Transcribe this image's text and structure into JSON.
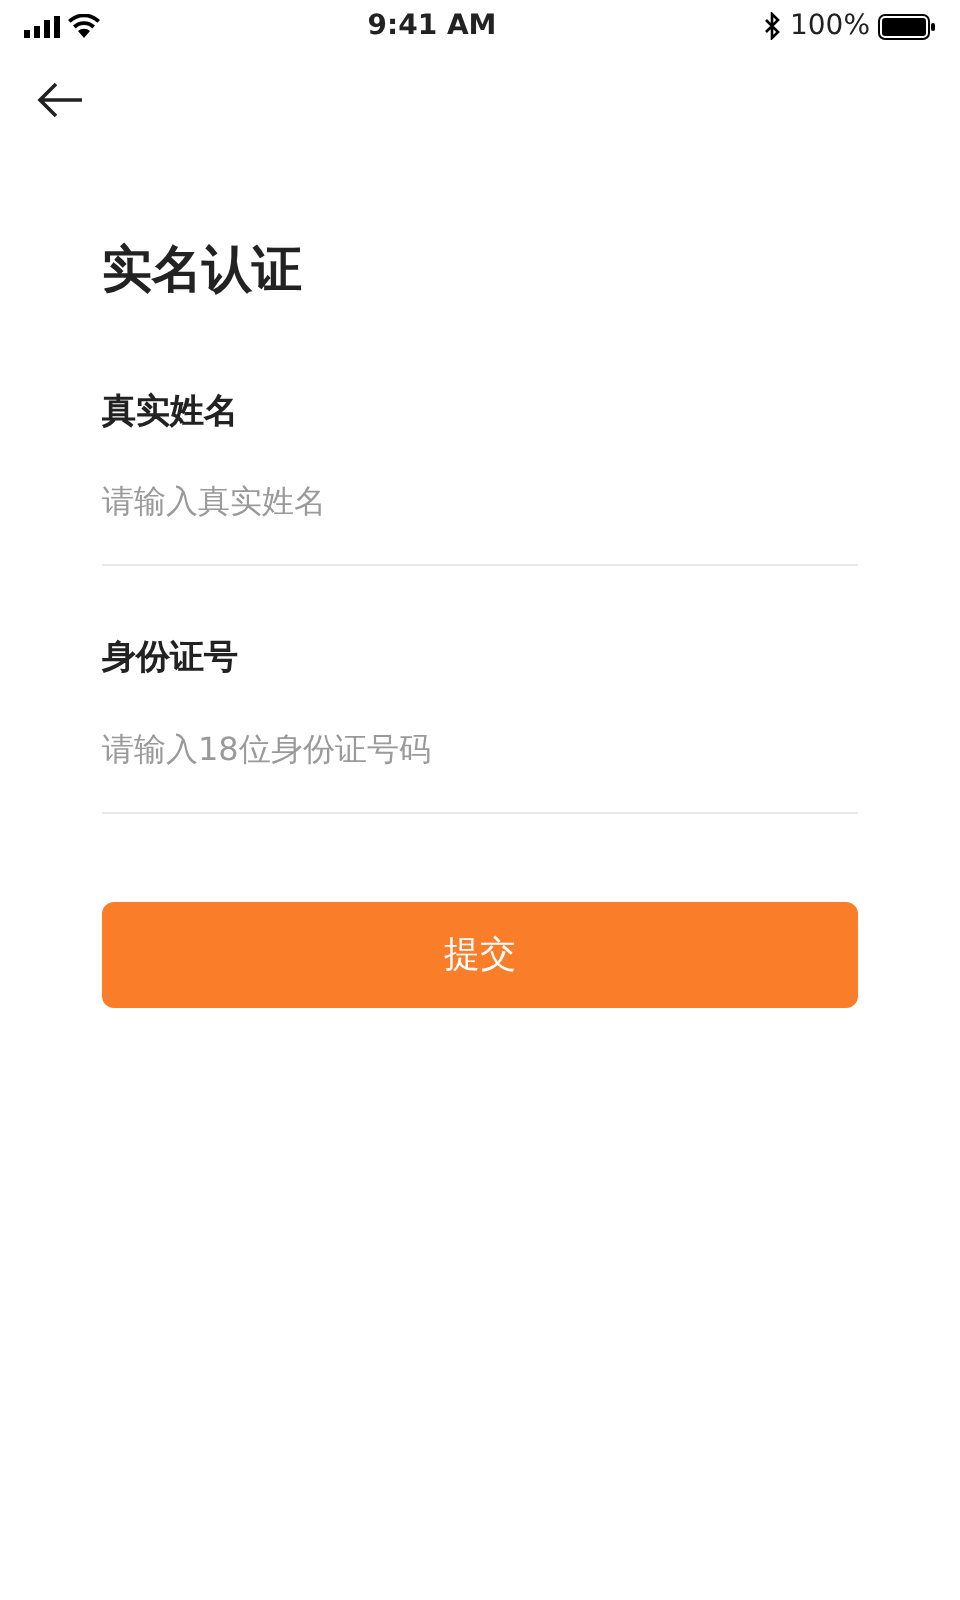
{
  "status_bar": {
    "time": "9:41 AM",
    "battery": "100%"
  },
  "title": "实名认证",
  "fields": [
    {
      "label": "真实姓名",
      "placeholder": "请输入真实姓名"
    },
    {
      "label": "身份证号",
      "placeholder": "请输入18位身份证号码"
    }
  ],
  "submit_button": "提交"
}
